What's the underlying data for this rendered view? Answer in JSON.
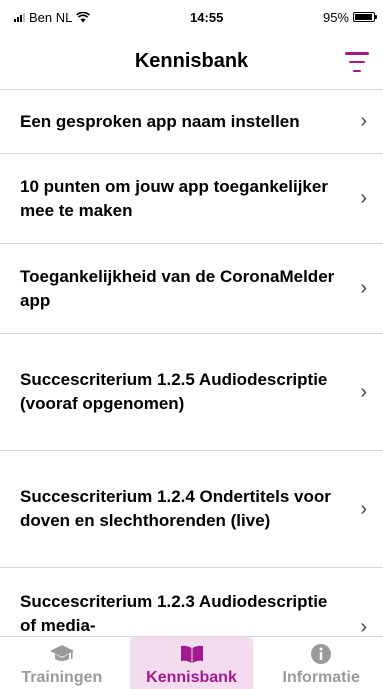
{
  "status_bar": {
    "carrier": "Ben NL",
    "time": "14:55",
    "battery_percent": "95%",
    "battery_level": 0.95
  },
  "header": {
    "title": "Kennisbank",
    "filter_icon": "filter-icon",
    "accent_color": "#a3198f"
  },
  "list": {
    "items": [
      {
        "label": "Een gesproken app naam instellen"
      },
      {
        "label": "10 punten om jouw app toegankelijker mee te maken"
      },
      {
        "label": "Toegankelijkheid van de CoronaMelder app"
      },
      {
        "label": "Succescriterium 1.2.5 Audiodescriptie (vooraf opgenomen)"
      },
      {
        "label": "Succescriterium 1.2.4 Ondertitels voor doven en slechthorenden (live)"
      },
      {
        "label": "Succescriterium 1.2.3 Audiodescriptie of media-"
      }
    ],
    "chevron": "›"
  },
  "tabbar": {
    "tabs": [
      {
        "label": "Trainingen",
        "icon": "graduation-cap-icon"
      },
      {
        "label": "Kennisbank",
        "icon": "book-icon",
        "active": true
      },
      {
        "label": "Informatie",
        "icon": "info-icon"
      }
    ]
  }
}
